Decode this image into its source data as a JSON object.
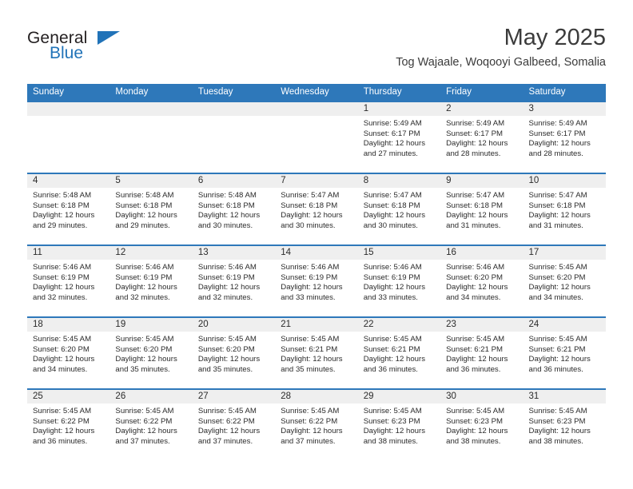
{
  "brand": {
    "name_top": "General",
    "name_bottom": "Blue",
    "accent_color": "#2173b8"
  },
  "header": {
    "month_title": "May 2025",
    "location": "Tog Wajaale, Woqooyi Galbeed, Somalia"
  },
  "calendar": {
    "header_color": "#2e78ba",
    "daynum_strip_color": "#efefef",
    "weekday_headers": [
      "Sunday",
      "Monday",
      "Tuesday",
      "Wednesday",
      "Thursday",
      "Friday",
      "Saturday"
    ],
    "labels": {
      "sunrise": "Sunrise:",
      "sunset": "Sunset:",
      "daylight": "Daylight:"
    },
    "weeks": [
      [
        {
          "day": "",
          "empty": true
        },
        {
          "day": "",
          "empty": true
        },
        {
          "day": "",
          "empty": true
        },
        {
          "day": "",
          "empty": true
        },
        {
          "day": "1",
          "sunrise": "Sunrise: 5:49 AM",
          "sunset": "Sunset: 6:17 PM",
          "daylight_line1": "Daylight: 12 hours",
          "daylight_line2": "and 27 minutes."
        },
        {
          "day": "2",
          "sunrise": "Sunrise: 5:49 AM",
          "sunset": "Sunset: 6:17 PM",
          "daylight_line1": "Daylight: 12 hours",
          "daylight_line2": "and 28 minutes."
        },
        {
          "day": "3",
          "sunrise": "Sunrise: 5:49 AM",
          "sunset": "Sunset: 6:17 PM",
          "daylight_line1": "Daylight: 12 hours",
          "daylight_line2": "and 28 minutes."
        }
      ],
      [
        {
          "day": "4",
          "sunrise": "Sunrise: 5:48 AM",
          "sunset": "Sunset: 6:18 PM",
          "daylight_line1": "Daylight: 12 hours",
          "daylight_line2": "and 29 minutes."
        },
        {
          "day": "5",
          "sunrise": "Sunrise: 5:48 AM",
          "sunset": "Sunset: 6:18 PM",
          "daylight_line1": "Daylight: 12 hours",
          "daylight_line2": "and 29 minutes."
        },
        {
          "day": "6",
          "sunrise": "Sunrise: 5:48 AM",
          "sunset": "Sunset: 6:18 PM",
          "daylight_line1": "Daylight: 12 hours",
          "daylight_line2": "and 30 minutes."
        },
        {
          "day": "7",
          "sunrise": "Sunrise: 5:47 AM",
          "sunset": "Sunset: 6:18 PM",
          "daylight_line1": "Daylight: 12 hours",
          "daylight_line2": "and 30 minutes."
        },
        {
          "day": "8",
          "sunrise": "Sunrise: 5:47 AM",
          "sunset": "Sunset: 6:18 PM",
          "daylight_line1": "Daylight: 12 hours",
          "daylight_line2": "and 30 minutes."
        },
        {
          "day": "9",
          "sunrise": "Sunrise: 5:47 AM",
          "sunset": "Sunset: 6:18 PM",
          "daylight_line1": "Daylight: 12 hours",
          "daylight_line2": "and 31 minutes."
        },
        {
          "day": "10",
          "sunrise": "Sunrise: 5:47 AM",
          "sunset": "Sunset: 6:18 PM",
          "daylight_line1": "Daylight: 12 hours",
          "daylight_line2": "and 31 minutes."
        }
      ],
      [
        {
          "day": "11",
          "sunrise": "Sunrise: 5:46 AM",
          "sunset": "Sunset: 6:19 PM",
          "daylight_line1": "Daylight: 12 hours",
          "daylight_line2": "and 32 minutes."
        },
        {
          "day": "12",
          "sunrise": "Sunrise: 5:46 AM",
          "sunset": "Sunset: 6:19 PM",
          "daylight_line1": "Daylight: 12 hours",
          "daylight_line2": "and 32 minutes."
        },
        {
          "day": "13",
          "sunrise": "Sunrise: 5:46 AM",
          "sunset": "Sunset: 6:19 PM",
          "daylight_line1": "Daylight: 12 hours",
          "daylight_line2": "and 32 minutes."
        },
        {
          "day": "14",
          "sunrise": "Sunrise: 5:46 AM",
          "sunset": "Sunset: 6:19 PM",
          "daylight_line1": "Daylight: 12 hours",
          "daylight_line2": "and 33 minutes."
        },
        {
          "day": "15",
          "sunrise": "Sunrise: 5:46 AM",
          "sunset": "Sunset: 6:19 PM",
          "daylight_line1": "Daylight: 12 hours",
          "daylight_line2": "and 33 minutes."
        },
        {
          "day": "16",
          "sunrise": "Sunrise: 5:46 AM",
          "sunset": "Sunset: 6:20 PM",
          "daylight_line1": "Daylight: 12 hours",
          "daylight_line2": "and 34 minutes."
        },
        {
          "day": "17",
          "sunrise": "Sunrise: 5:45 AM",
          "sunset": "Sunset: 6:20 PM",
          "daylight_line1": "Daylight: 12 hours",
          "daylight_line2": "and 34 minutes."
        }
      ],
      [
        {
          "day": "18",
          "sunrise": "Sunrise: 5:45 AM",
          "sunset": "Sunset: 6:20 PM",
          "daylight_line1": "Daylight: 12 hours",
          "daylight_line2": "and 34 minutes."
        },
        {
          "day": "19",
          "sunrise": "Sunrise: 5:45 AM",
          "sunset": "Sunset: 6:20 PM",
          "daylight_line1": "Daylight: 12 hours",
          "daylight_line2": "and 35 minutes."
        },
        {
          "day": "20",
          "sunrise": "Sunrise: 5:45 AM",
          "sunset": "Sunset: 6:20 PM",
          "daylight_line1": "Daylight: 12 hours",
          "daylight_line2": "and 35 minutes."
        },
        {
          "day": "21",
          "sunrise": "Sunrise: 5:45 AM",
          "sunset": "Sunset: 6:21 PM",
          "daylight_line1": "Daylight: 12 hours",
          "daylight_line2": "and 35 minutes."
        },
        {
          "day": "22",
          "sunrise": "Sunrise: 5:45 AM",
          "sunset": "Sunset: 6:21 PM",
          "daylight_line1": "Daylight: 12 hours",
          "daylight_line2": "and 36 minutes."
        },
        {
          "day": "23",
          "sunrise": "Sunrise: 5:45 AM",
          "sunset": "Sunset: 6:21 PM",
          "daylight_line1": "Daylight: 12 hours",
          "daylight_line2": "and 36 minutes."
        },
        {
          "day": "24",
          "sunrise": "Sunrise: 5:45 AM",
          "sunset": "Sunset: 6:21 PM",
          "daylight_line1": "Daylight: 12 hours",
          "daylight_line2": "and 36 minutes."
        }
      ],
      [
        {
          "day": "25",
          "sunrise": "Sunrise: 5:45 AM",
          "sunset": "Sunset: 6:22 PM",
          "daylight_line1": "Daylight: 12 hours",
          "daylight_line2": "and 36 minutes."
        },
        {
          "day": "26",
          "sunrise": "Sunrise: 5:45 AM",
          "sunset": "Sunset: 6:22 PM",
          "daylight_line1": "Daylight: 12 hours",
          "daylight_line2": "and 37 minutes."
        },
        {
          "day": "27",
          "sunrise": "Sunrise: 5:45 AM",
          "sunset": "Sunset: 6:22 PM",
          "daylight_line1": "Daylight: 12 hours",
          "daylight_line2": "and 37 minutes."
        },
        {
          "day": "28",
          "sunrise": "Sunrise: 5:45 AM",
          "sunset": "Sunset: 6:22 PM",
          "daylight_line1": "Daylight: 12 hours",
          "daylight_line2": "and 37 minutes."
        },
        {
          "day": "29",
          "sunrise": "Sunrise: 5:45 AM",
          "sunset": "Sunset: 6:23 PM",
          "daylight_line1": "Daylight: 12 hours",
          "daylight_line2": "and 38 minutes."
        },
        {
          "day": "30",
          "sunrise": "Sunrise: 5:45 AM",
          "sunset": "Sunset: 6:23 PM",
          "daylight_line1": "Daylight: 12 hours",
          "daylight_line2": "and 38 minutes."
        },
        {
          "day": "31",
          "sunrise": "Sunrise: 5:45 AM",
          "sunset": "Sunset: 6:23 PM",
          "daylight_line1": "Daylight: 12 hours",
          "daylight_line2": "and 38 minutes."
        }
      ]
    ]
  }
}
